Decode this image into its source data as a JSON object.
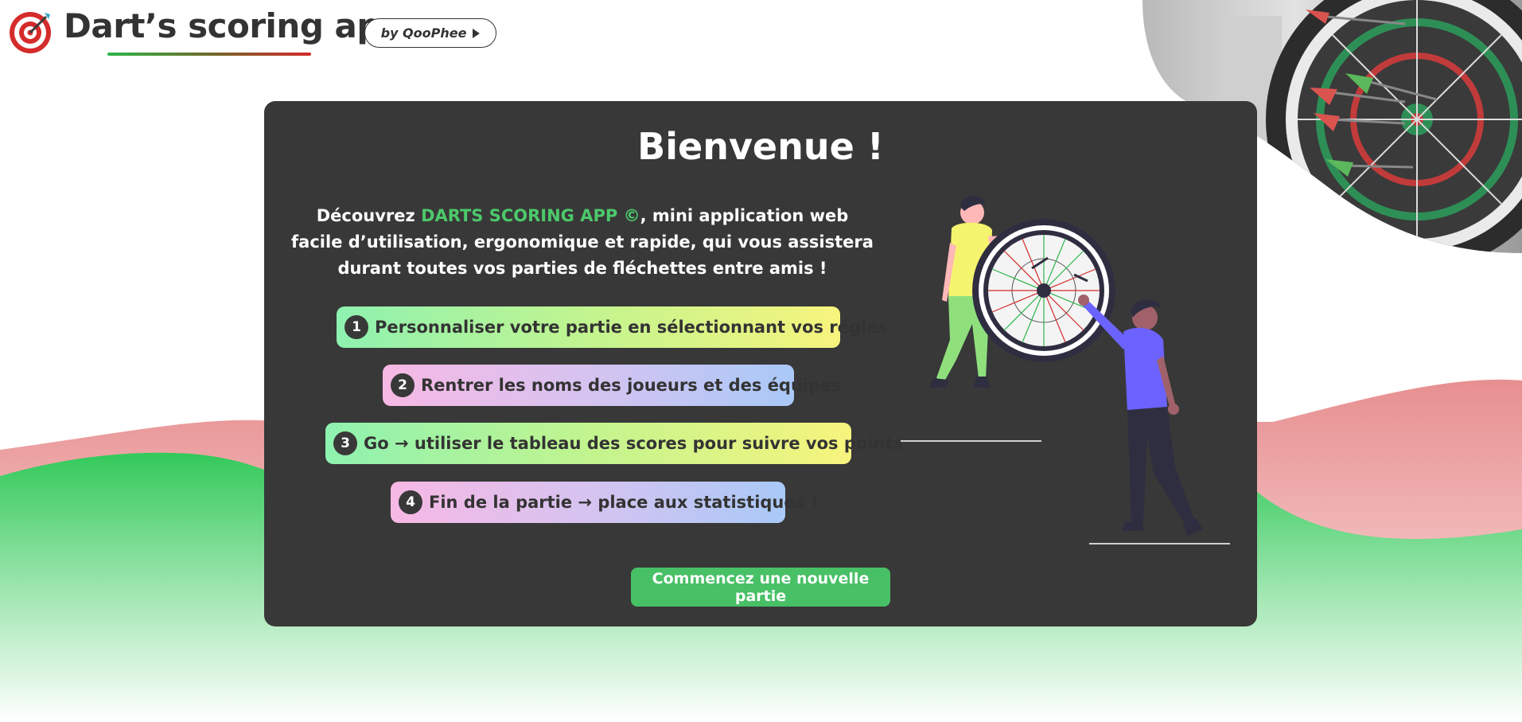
{
  "header": {
    "title": "Dart’s scoring app",
    "by_label": "by QooPhee",
    "logo_icon": "dartboard-target-icon"
  },
  "card": {
    "title": "Bienvenue !",
    "intro": {
      "before": "Découvrez ",
      "brand": "DARTS SCORING APP ©",
      "after": ", mini application web facile d’utilisation, ergonomique et rapide, qui vous assistera durant toutes vos parties de fléchettes entre amis !"
    },
    "steps": [
      {
        "num": "1",
        "text": "Personnaliser votre partie en sélectionnant vos régles"
      },
      {
        "num": "2",
        "text": "Rentrer les noms des joueurs et des équipes"
      },
      {
        "num": "3",
        "text": "Go → utiliser le tableau des scores pour suivre vos points"
      },
      {
        "num": "4",
        "text": "Fin de la partie → place aux statistiques !"
      }
    ],
    "cta_label": "Commencez une nouvelle partie"
  },
  "colors": {
    "card_bg": "#383838",
    "accent_green": "#48c066",
    "brand_green": "#4cc96a",
    "wave_red": "#e99a9a",
    "wave_green": "#33c95a",
    "person_purple": "#6c63ff",
    "person_yellow": "#f7f47d"
  }
}
